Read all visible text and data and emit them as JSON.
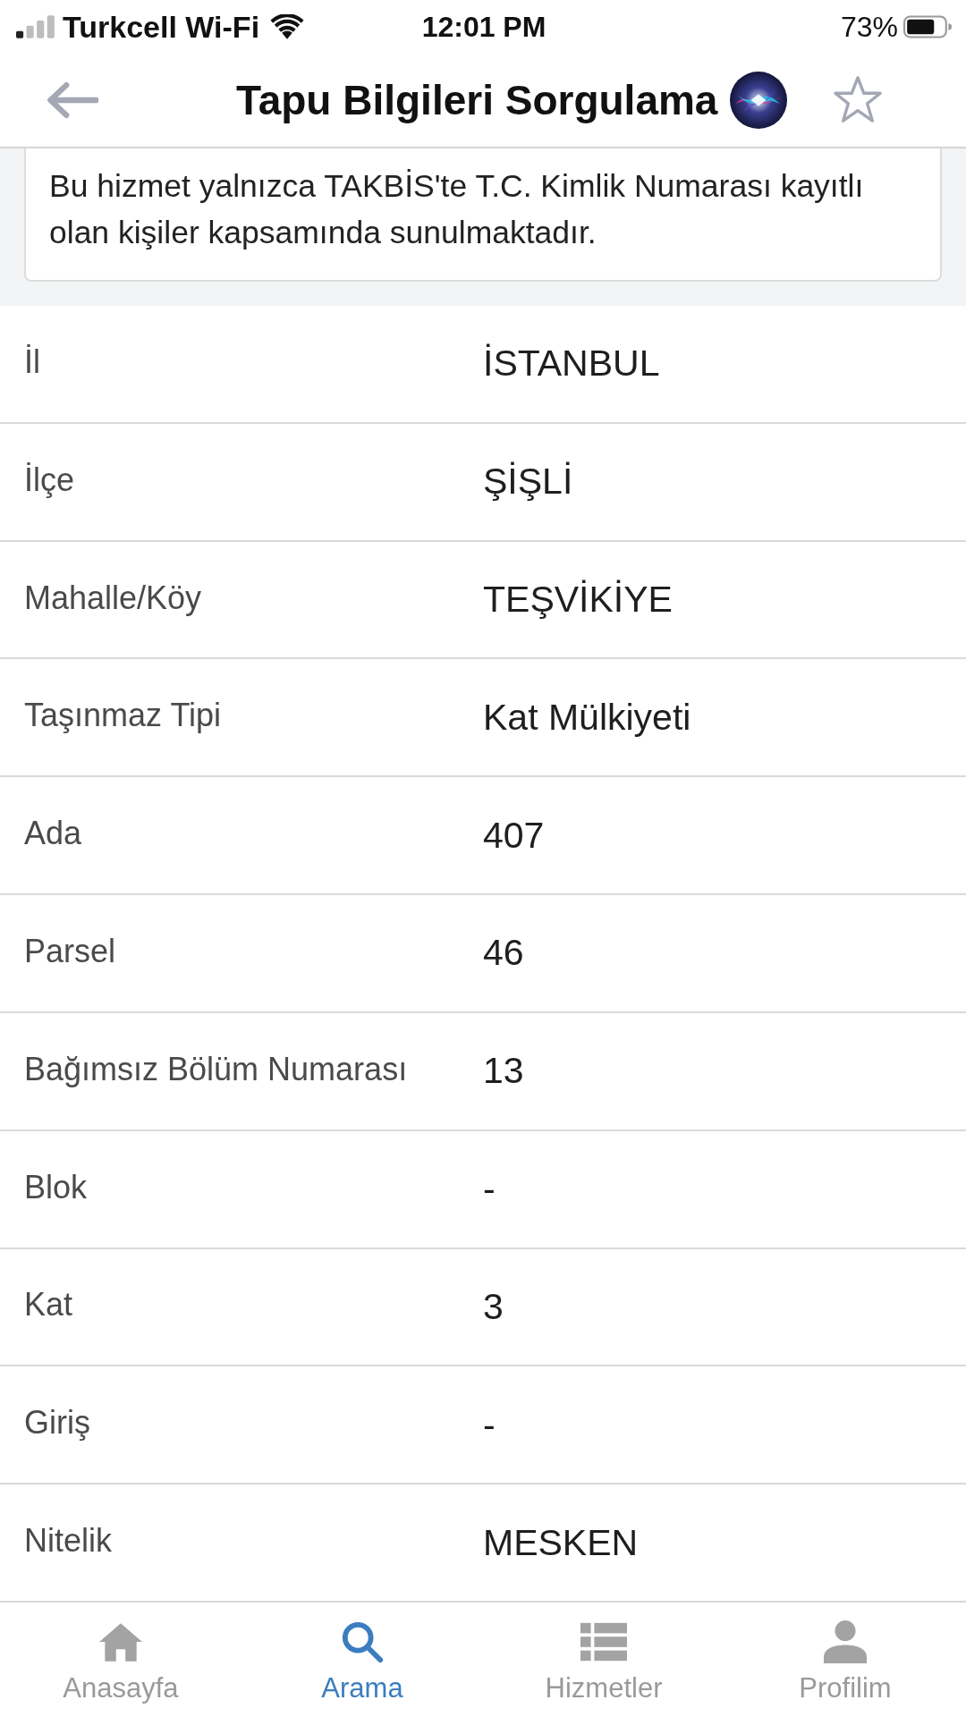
{
  "status_bar": {
    "carrier": "Turkcell Wi-Fi",
    "time": "12:01 PM",
    "battery": "73%"
  },
  "header": {
    "title": "Tapu Bilgileri Sorgulama"
  },
  "notice": {
    "text": "Bu hizmet yalnızca TAKBİS'te T.C. Kimlik Numarası kayıtlı olan kişiler kapsamında sunulmaktadır."
  },
  "fields": [
    {
      "label": "İl",
      "value": "İSTANBUL"
    },
    {
      "label": "İlçe",
      "value": "ŞİŞLİ"
    },
    {
      "label": "Mahalle/Köy",
      "value": "TEŞVİKİYE"
    },
    {
      "label": "Taşınmaz Tipi",
      "value": "Kat Mülkiyeti"
    },
    {
      "label": "Ada",
      "value": "407"
    },
    {
      "label": "Parsel",
      "value": "46"
    },
    {
      "label": "Bağımsız Bölüm Numarası",
      "value": "13"
    },
    {
      "label": "Blok",
      "value": "-"
    },
    {
      "label": "Kat",
      "value": "3"
    },
    {
      "label": "Giriş",
      "value": "-"
    },
    {
      "label": "Nitelik",
      "value": "MESKEN"
    }
  ],
  "tab_bar": [
    {
      "kind": "home",
      "label": "Anasayfa",
      "selected": false
    },
    {
      "kind": "search",
      "label": "Arama",
      "selected": true
    },
    {
      "kind": "list",
      "label": "Hizmetler",
      "selected": false
    },
    {
      "kind": "person",
      "label": "Profilim",
      "selected": false
    }
  ]
}
